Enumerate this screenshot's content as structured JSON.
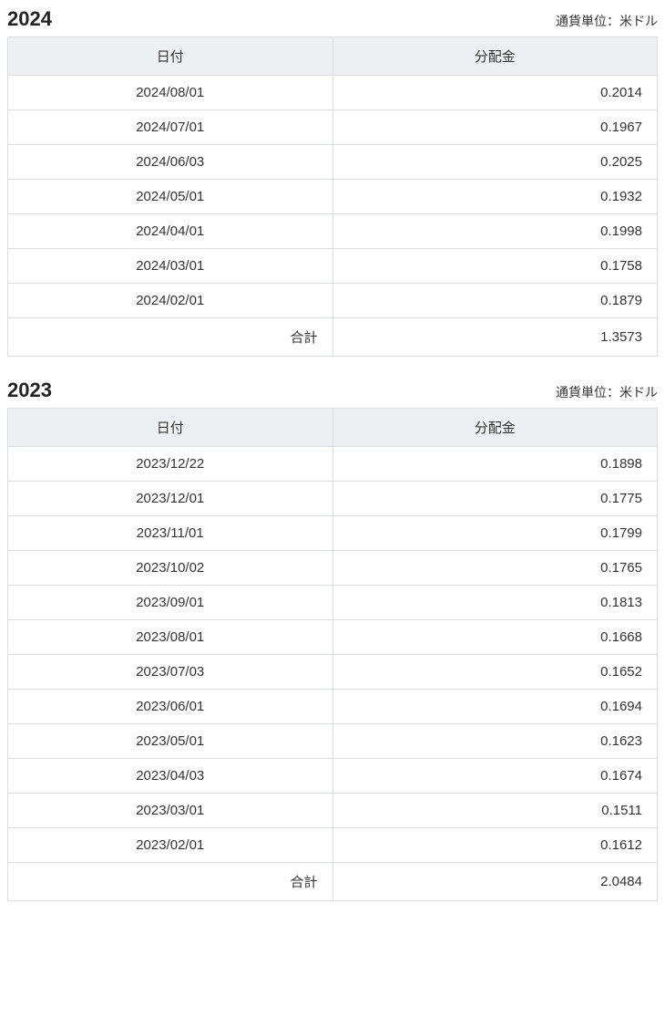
{
  "column_headers": {
    "date": "日付",
    "amount": "分配金"
  },
  "currency_note": "通貨単位：米ドル",
  "total_label": "合計",
  "sections": [
    {
      "year": "2024",
      "rows": [
        {
          "date": "2024/08/01",
          "amount": "0.2014"
        },
        {
          "date": "2024/07/01",
          "amount": "0.1967"
        },
        {
          "date": "2024/06/03",
          "amount": "0.2025"
        },
        {
          "date": "2024/05/01",
          "amount": "0.1932"
        },
        {
          "date": "2024/04/01",
          "amount": "0.1998"
        },
        {
          "date": "2024/03/01",
          "amount": "0.1758"
        },
        {
          "date": "2024/02/01",
          "amount": "0.1879"
        }
      ],
      "total": "1.3573"
    },
    {
      "year": "2023",
      "rows": [
        {
          "date": "2023/12/22",
          "amount": "0.1898"
        },
        {
          "date": "2023/12/01",
          "amount": "0.1775"
        },
        {
          "date": "2023/11/01",
          "amount": "0.1799"
        },
        {
          "date": "2023/10/02",
          "amount": "0.1765"
        },
        {
          "date": "2023/09/01",
          "amount": "0.1813"
        },
        {
          "date": "2023/08/01",
          "amount": "0.1668"
        },
        {
          "date": "2023/07/03",
          "amount": "0.1652"
        },
        {
          "date": "2023/06/01",
          "amount": "0.1694"
        },
        {
          "date": "2023/05/01",
          "amount": "0.1623"
        },
        {
          "date": "2023/04/03",
          "amount": "0.1674"
        },
        {
          "date": "2023/03/01",
          "amount": "0.1511"
        },
        {
          "date": "2023/02/01",
          "amount": "0.1612"
        }
      ],
      "total": "2.0484"
    }
  ]
}
